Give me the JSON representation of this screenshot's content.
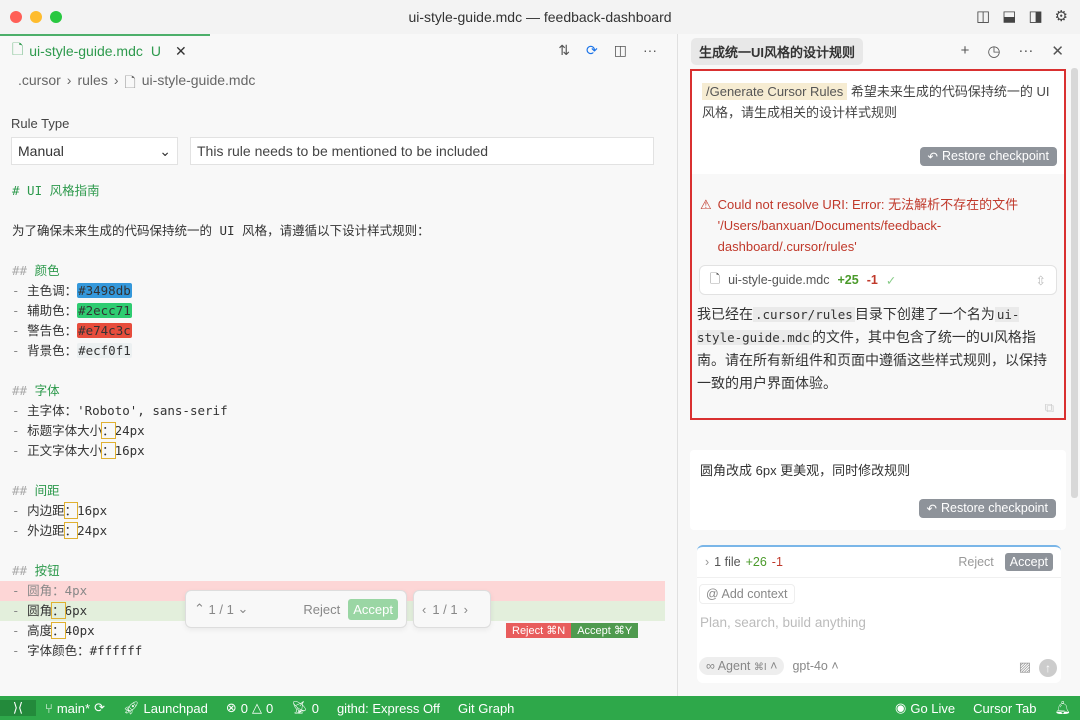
{
  "window": {
    "title": "ui-style-guide.mdc — feedback-dashboard"
  },
  "tab": {
    "label": "ui-style-guide.mdc",
    "status": "U"
  },
  "breadcrumb": [
    ".cursor",
    "rules",
    "ui-style-guide.mdc"
  ],
  "rule": {
    "type_label": "Rule Type",
    "type_value": "Manual",
    "description": "This rule needs to be mentioned to be included"
  },
  "code_lines": [
    {
      "k": "h1",
      "t": "# UI 风格指南"
    },
    {
      "k": "blank",
      "t": ""
    },
    {
      "k": "text",
      "t": "为了确保未来生成的代码保持统一的 UI 风格，请遵循以下设计样式规则："
    },
    {
      "k": "blank",
      "t": ""
    },
    {
      "k": "h2",
      "t": "颜色"
    },
    {
      "k": "item",
      "label": "主色调：",
      "value": "#3498db",
      "sw": "#3498db"
    },
    {
      "k": "item",
      "label": "辅助色：",
      "value": "#2ecc71",
      "sw": "#2ecc71"
    },
    {
      "k": "item",
      "label": "警告色：",
      "value": "#e74c3c",
      "sw": "#e74c3c"
    },
    {
      "k": "item",
      "label": "背景色：",
      "value": "#ecf0f1",
      "sw": "#ecf0f1"
    },
    {
      "k": "blank",
      "t": ""
    },
    {
      "k": "h2",
      "t": "字体"
    },
    {
      "k": "item",
      "label": "主字体：",
      "value": "'Roboto', sans-serif"
    },
    {
      "k": "item",
      "label": "标题字体大小",
      "colon": "：",
      "value": "24px"
    },
    {
      "k": "item",
      "label": "正文字体大小",
      "colon": "：",
      "value": "16px"
    },
    {
      "k": "blank",
      "t": ""
    },
    {
      "k": "h2",
      "t": "间距"
    },
    {
      "k": "item",
      "label": "内边距",
      "colon": "：",
      "value": "16px"
    },
    {
      "k": "item",
      "label": "外边距",
      "colon": "：",
      "value": "24px"
    },
    {
      "k": "blank",
      "t": ""
    },
    {
      "k": "h2",
      "t": "按钮"
    },
    {
      "k": "item",
      "label": "圆角：",
      "value": "4px",
      "diff": "del"
    },
    {
      "k": "item",
      "label": "圆角",
      "colon": "：",
      "value": "6px",
      "diff": "add"
    },
    {
      "k": "item",
      "label": "高度",
      "colon": "：",
      "value": "40px"
    },
    {
      "k": "item",
      "label": "字体颜色：",
      "value": "#ffffff"
    }
  ],
  "diff_nav": {
    "counter": "1 / 1",
    "reject": "Reject",
    "accept": "Accept",
    "file_counter": "1 / 1",
    "reject_kbd": "Reject ⌘N",
    "accept_kbd": "Accept ⌘Y"
  },
  "chat": {
    "title": "生成统一UI风格的设计规则",
    "user_cmd": "/Generate Cursor Rules",
    "user_msg": "希望未来生成的代码保持统一的 UI 风格，请生成相关的设计样式规则",
    "restore": "Restore checkpoint",
    "error": "Could not resolve URI: Error: 无法解析不存在的文件 '/Users/banxuan/Documents/feedback-dashboard/.cursor/rules'",
    "file_chip": {
      "name": "ui-style-guide.mdc",
      "added": "+25",
      "removed": "-1"
    },
    "resp_1": "我已经在",
    "resp_code1": ".cursor/rules",
    "resp_2": "目录下创建了一个名为",
    "resp_code2": "ui-style-guide.mdc",
    "resp_3": "的文件，其中包含了统一的UI风格指南。请在所有新组件和页面中遵循这些样式规则，以保持一致的用户界面体验。",
    "user_msg2": "圆角改成 6px 更美观，同时修改规则",
    "restore2": "Restore checkpoint",
    "pending": {
      "files": "1 file",
      "added": "+26",
      "removed": "-1",
      "reject": "Reject",
      "accept": "Accept"
    },
    "add_context": "Add context",
    "placeholder": "Plan, search, build anything",
    "mode": "Agent",
    "mode_kbd": "⌘I",
    "model": "gpt-4o"
  },
  "status": {
    "branch": "main*",
    "launchpad": "Launchpad",
    "errors": "0",
    "warnings": "0",
    "ports": "0",
    "githd": "githd: Express Off",
    "gitgraph": "Git Graph",
    "golive": "Go Live",
    "cursortab": "Cursor Tab"
  },
  "colors": {
    "accent": "#2ea84a",
    "error": "#c0392b",
    "highlight": "#d93030"
  }
}
